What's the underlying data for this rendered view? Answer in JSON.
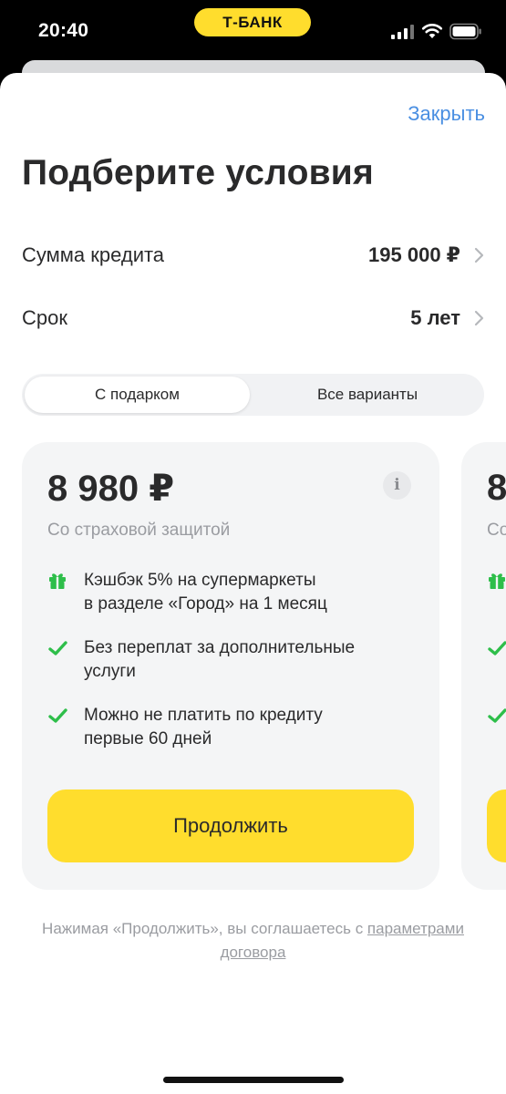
{
  "status_bar": {
    "time": "20:40",
    "brand": "Т-БАНК"
  },
  "header": {
    "close_label": "Закрыть",
    "title": "Подберите условия"
  },
  "params": [
    {
      "label": "Сумма кредита",
      "value": "195 000 ₽"
    },
    {
      "label": "Срок",
      "value": "5 лет"
    }
  ],
  "tabs": {
    "active": "С подарком",
    "inactive": "Все варианты"
  },
  "offer": {
    "price": "8 980 ₽",
    "info_glyph": "i",
    "subtitle": "Со страховой защитой",
    "features": [
      {
        "icon": "gift-icon",
        "text": "Кэшбэк 5% на супермаркеты\nв разделе «Город» на 1 месяц"
      },
      {
        "icon": "check-icon",
        "text": "Без переплат за дополнительные\nуслуги"
      },
      {
        "icon": "check-icon",
        "text": "Можно не платить по кредиту\nпервые 60 дней"
      }
    ],
    "button_label": "Продолжить"
  },
  "next_offer_peek": {
    "price_partial": "8",
    "subtitle_partial": "Со"
  },
  "disclaimer": {
    "text_before": "Нажимая «Продолжить», вы соглашаетесь с ",
    "link_text": "параметрами договора"
  },
  "colors": {
    "accent_yellow": "#FFDD2D",
    "link_blue": "#4A8FE2",
    "icon_green": "#2EBE4A"
  }
}
